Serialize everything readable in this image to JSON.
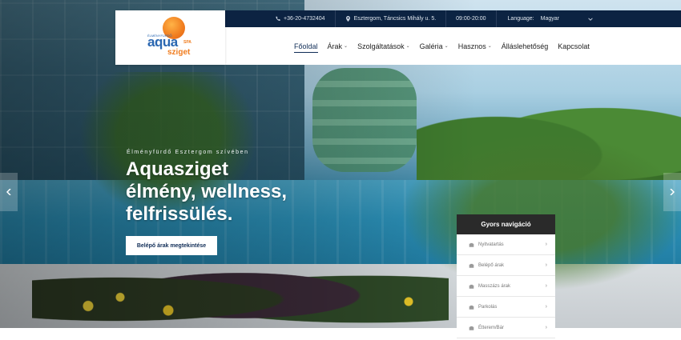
{
  "topbar": {
    "phone": "+36-20-4732404",
    "address": "Esztergom, Táncsics Mihály u. 5.",
    "hours": "09:00-20:00",
    "language_label": "Language:",
    "language_value": "Magyar"
  },
  "logo": {
    "brand_main": "aqua",
    "brand_suffix": "sziget",
    "brand_small": "SPA",
    "brand_top": "ÉLMÉNYFÜRDŐ"
  },
  "nav": {
    "items": [
      {
        "label": "Főoldal",
        "active": true,
        "has_dropdown": false
      },
      {
        "label": "Árak",
        "active": false,
        "has_dropdown": true
      },
      {
        "label": "Szolgáltatások",
        "active": false,
        "has_dropdown": true
      },
      {
        "label": "Galéria",
        "active": false,
        "has_dropdown": true
      },
      {
        "label": "Hasznos",
        "active": false,
        "has_dropdown": true
      },
      {
        "label": "Álláslehetőség",
        "active": false,
        "has_dropdown": false
      },
      {
        "label": "Kapcsolat",
        "active": false,
        "has_dropdown": false
      }
    ]
  },
  "hero": {
    "eyebrow": "Élményfürdő Esztergom szívében",
    "headline_lines": [
      "Aquasziget",
      "élmény, wellness,",
      "felfrissülés."
    ],
    "cta_label": "Belépő árak megtekintése"
  },
  "quick_nav": {
    "title": "Gyors navigáció",
    "items": [
      {
        "label": "Nyitvatartás"
      },
      {
        "label": "Belépő árak"
      },
      {
        "label": "Masszázs árak"
      },
      {
        "label": "Parkolás"
      },
      {
        "label": "Étterem/Bár"
      }
    ]
  },
  "colors": {
    "topbar_bg": "#0c2342",
    "accent_navy": "#0f2c56",
    "logo_blue": "#2a67b1",
    "logo_orange": "#f07c1e"
  },
  "icons": {
    "phone": "phone-icon",
    "address": "map-pin-icon",
    "language_chevron": "chevron-down-icon",
    "slider_prev": "chevron-left-icon",
    "slider_next": "chevron-right-icon",
    "quick_nav_item": "briefcase-icon"
  }
}
